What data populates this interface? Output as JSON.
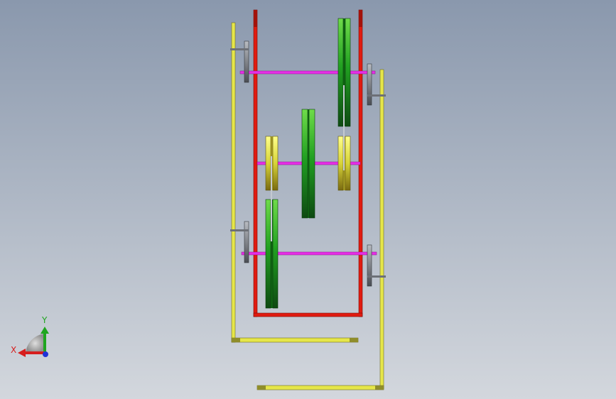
{
  "viewport": {
    "background_top": "#8a98ad",
    "background_bottom": "#d3d7dd"
  },
  "colors": {
    "frame_red": "#e01b10",
    "frame_yellow": "#e6e64a",
    "shaft_magenta": "#e62ee6",
    "pulley_green": "#22a322",
    "bearing_gray": "#6d7077",
    "axis_x": "#d61e1e",
    "axis_y": "#1fa51f",
    "axis_z": "#2032d6"
  },
  "triad": {
    "x_label": "X",
    "y_label": "Y",
    "x_icon": "x-axis-arrow-icon",
    "y_icon": "y-axis-arrow-icon",
    "z_icon": "z-axis-dot-icon"
  }
}
